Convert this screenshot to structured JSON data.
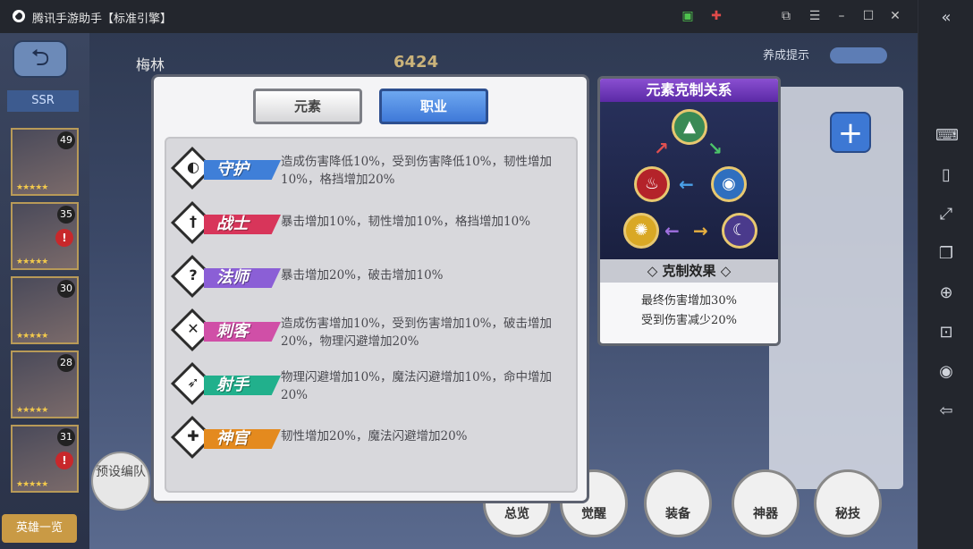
{
  "window": {
    "title": "腾讯手游助手【标准引擎】"
  },
  "game": {
    "ssr_tab": "SSR",
    "hero_name": "梅林",
    "power": "6424",
    "nurture_hint": "养成提示",
    "hero_list_button": "英雄一览",
    "preset_button": "预设编队",
    "hero_cards": [
      {
        "level": "49",
        "alert": ""
      },
      {
        "level": "35",
        "alert": "!"
      },
      {
        "level": "30",
        "alert": ""
      },
      {
        "level": "28",
        "alert": ""
      },
      {
        "level": "31",
        "alert": "!"
      }
    ],
    "bottom_buttons": [
      "总览",
      "觉醒",
      "装备",
      "神器",
      "秘技"
    ]
  },
  "dialog": {
    "tab_element": "元素",
    "tab_class": "职业",
    "classes": [
      {
        "name": "守护",
        "color": "#3f7fd8",
        "icon": "shield-icon",
        "glyph": "◐",
        "description": "造成伤害降低10%，受到伤害降低10%，韧性增加10%，格挡增加20%"
      },
      {
        "name": "战士",
        "color": "#d8355a",
        "icon": "sword-icon",
        "glyph": "†",
        "description": "暴击增加10%，韧性增加10%，格挡增加10%"
      },
      {
        "name": "法师",
        "color": "#8b5fd6",
        "icon": "magic-icon",
        "glyph": "?",
        "description": "暴击增加20%，破击增加10%"
      },
      {
        "name": "刺客",
        "color": "#d04fa7",
        "icon": "daggers-icon",
        "glyph": "✕",
        "description": "造成伤害增加10%，受到伤害增加10%，破击增加20%，物理闪避增加20%"
      },
      {
        "name": "射手",
        "color": "#21b08c",
        "icon": "bow-icon",
        "glyph": "➶",
        "description": "物理闪避增加10%，魔法闪避增加10%，命中增加20%"
      },
      {
        "name": "神官",
        "color": "#e48a1e",
        "icon": "cross-icon",
        "glyph": "✚",
        "description": "韧性增加20%，魔法闪避增加20%"
      }
    ]
  },
  "relation": {
    "title": "元素克制关系",
    "effect_title": "克制效果",
    "effects": [
      "最终伤害增加30%",
      "受到伤害减少20%"
    ],
    "orbs": [
      {
        "icon": "wind-icon",
        "glyph": "▲",
        "color": "#3a8a55"
      },
      {
        "icon": "fire-icon",
        "glyph": "♨",
        "color": "#b4232a"
      },
      {
        "icon": "water-icon",
        "glyph": "◉",
        "color": "#2f6fbf"
      },
      {
        "icon": "light-icon",
        "glyph": "✺",
        "color": "#d9a825"
      },
      {
        "icon": "dark-icon",
        "glyph": "☾",
        "color": "#4a3a8c"
      }
    ]
  }
}
